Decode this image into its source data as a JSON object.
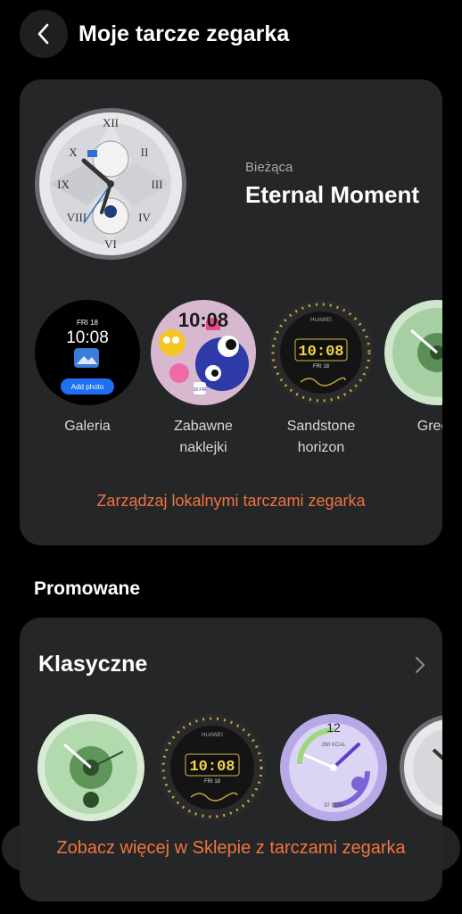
{
  "header": {
    "title": "Moje tarcze zegarka"
  },
  "current": {
    "label": "Bieżąca",
    "name": "Eternal Moment"
  },
  "faces": [
    {
      "label": "Galeria",
      "date": "FRI 18",
      "time": "10:08",
      "button": "Add photo"
    },
    {
      "label": "Zabawne naklejki",
      "time": "10:08",
      "date": "18 FRI"
    },
    {
      "label": "Sandstone horizon",
      "time": "10:08",
      "date": "FRI 18",
      "brand": "HUAWEI"
    },
    {
      "label": "Green"
    }
  ],
  "manage_link": "Zarządzaj lokalnymi tarczami zegarka",
  "promo": {
    "section_title": "Promowane",
    "category": "Klasyczne",
    "store_link": "Zobacz więcej w Sklepie z tarczami zegarka",
    "faces": [
      {
        "name": "green-face"
      },
      {
        "name": "huawei-gold",
        "time": "10:08",
        "date": "FRI 18",
        "brand": "HUAWEI"
      },
      {
        "name": "purple-face",
        "number": "12",
        "kcal": "260 KCAL",
        "bpm": "97 BPM"
      },
      {
        "name": "classic-white"
      }
    ]
  },
  "colors": {
    "accent": "#f0743f",
    "card": "#252628",
    "background": "#000000"
  }
}
